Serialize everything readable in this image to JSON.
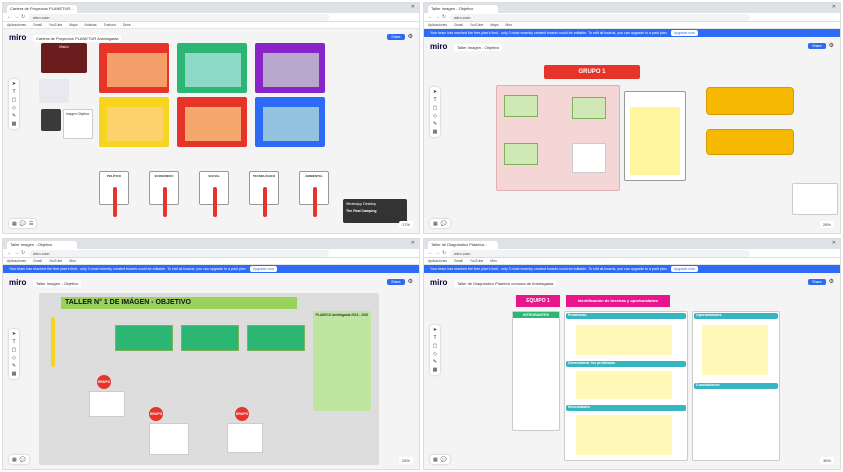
{
  "panes": [
    {
      "tab": "Cartera de Proyectos PLANETUR...",
      "url": "miro.com",
      "board": "Cartera de Proyectos PLANETUR Antofagasta",
      "categories": [
        "POLÍTICO",
        "ECONÓMICO",
        "SOCIAL",
        "TECNOLÓGICO",
        "AMBIENTAL"
      ],
      "mission": "Misión",
      "vision": "Visión",
      "image": "Imagen Objetivo",
      "toast_title": "WhatsApp Desktop",
      "toast_body": "The Real Camping",
      "zoom": "17%"
    },
    {
      "tab": "Taller Imagen - Objetivo",
      "url": "miro.com",
      "board": "Taller Imagen - Objetivo",
      "banner": "Your team has reached the free plan's limit - only 3 most recently created boards could be editable. To edit all boards, you can upgrade to a paid plan",
      "upgrade": "Upgrade now",
      "title": "GRUPO 1",
      "zoom": "28%"
    },
    {
      "tab": "Taller Imagen - Objetivo",
      "url": "miro.com",
      "board": "Taller Imagen - Objetivo",
      "banner": "Your team has reached the free plan's limit - only 3 most recently created boards could be editable. To edit all boards, you can upgrade to a paid plan",
      "upgrade": "Upgrade now",
      "title": "TALLER N° 1 DE IMÁGEN - OBJETIVO",
      "side_title": "PLADECO Antofagasta 2013 - 2022",
      "circles": [
        "GRUPO",
        "GRUPO",
        "GRUPO"
      ],
      "zoom": "28%"
    },
    {
      "tab": "Taller de Diagnóstico Pladetur...",
      "url": "miro.com",
      "board": "Taller de Diagnóstico Pladetur comuna de Antofagasta",
      "banner": "Your team has reached the free plan's limit - only 3 most recently created boards could be editable. To edit all boards, you can upgrade to a paid plan",
      "upgrade": "Upgrade now",
      "equipo": "EQUIPO 1",
      "heading": "Identificación de brechas y oportunidades",
      "integrantes": "INTEGRANTES",
      "problemas": "Problemas",
      "oportunidades": "Oportunidades",
      "dimensionar": "Dimensionar los problemas",
      "necesidades": "Necesidades",
      "conclusiones": "Conclusiones",
      "zoom": "36%"
    }
  ],
  "bookmarks": [
    "Aplicaciones",
    "Gmail",
    "YouTube",
    "Maps",
    "Noticias",
    "Traducir",
    "Drive",
    "Miro"
  ],
  "colors": {
    "blue": "#2d6af6",
    "red": "#e7342a",
    "green": "#2bb673",
    "purple": "#8a24c9",
    "yellow": "#f6d41f",
    "pink": "#e8168a",
    "orange": "#f6b800"
  }
}
